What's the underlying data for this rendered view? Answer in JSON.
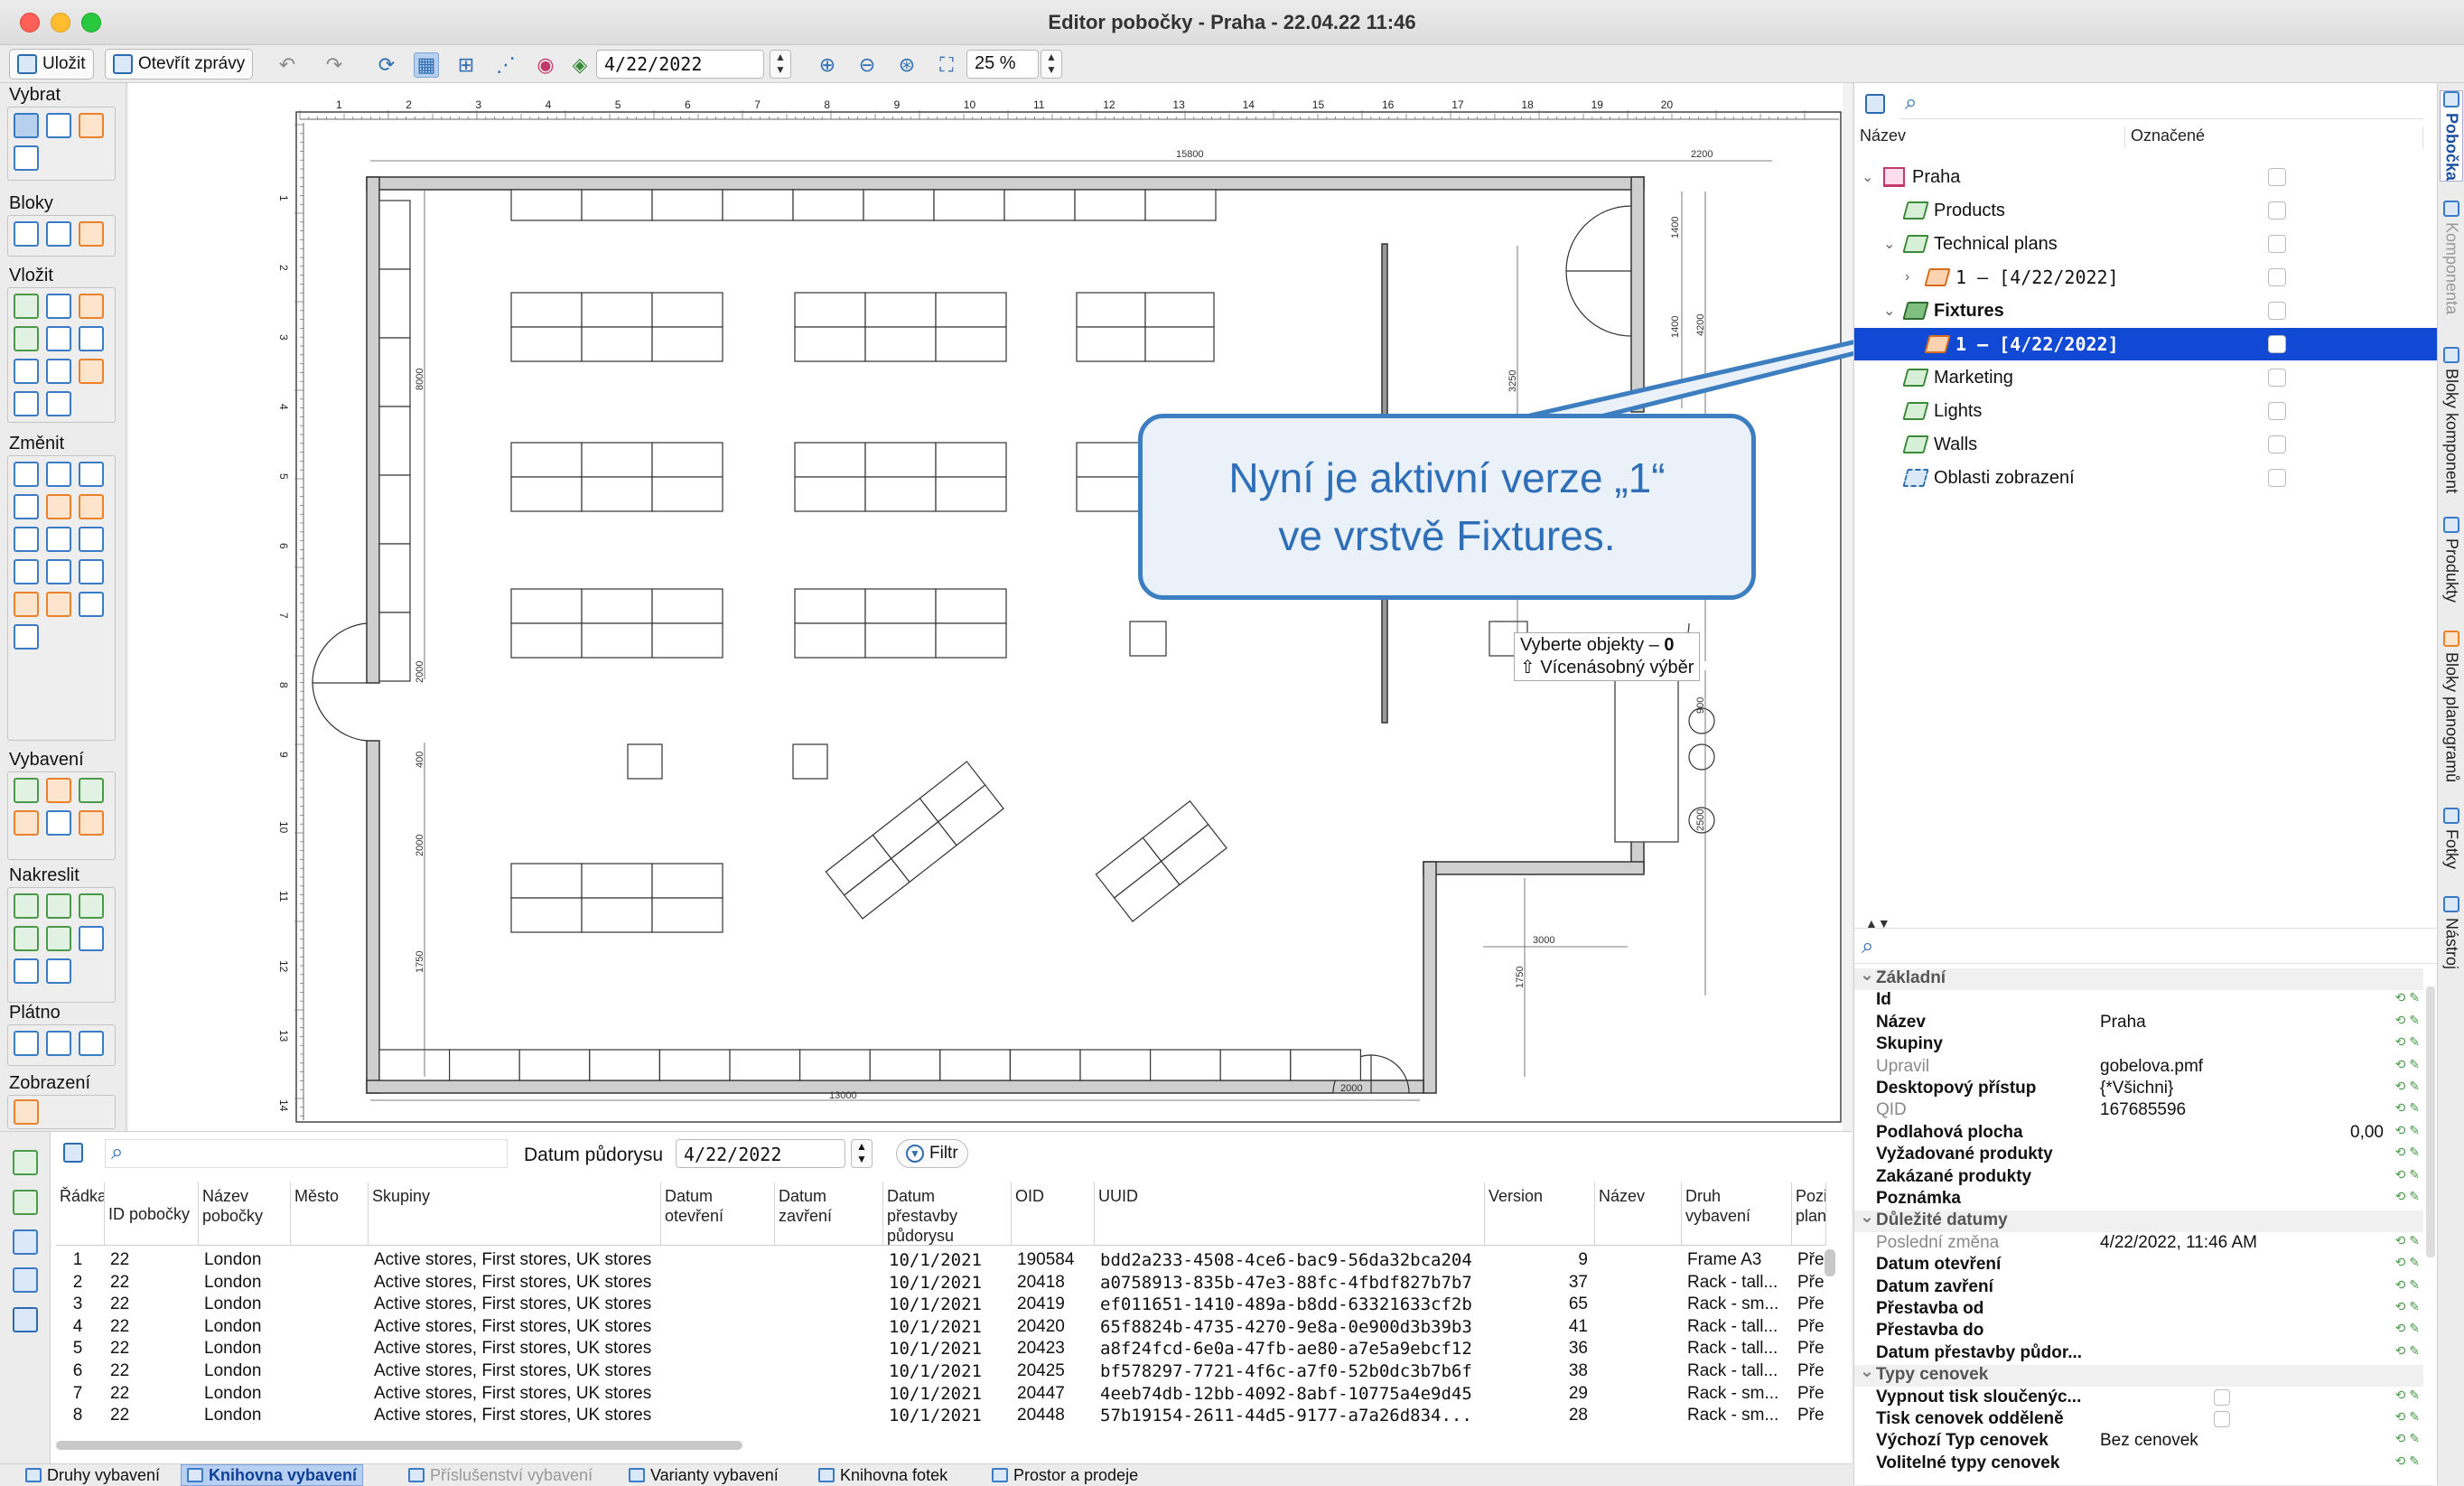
{
  "window": {
    "title": "Editor pobočky - Praha - 22.04.22 11:46"
  },
  "toolbar": {
    "save_label": "Uložit",
    "open_reports_label": "Otevřít zprávy",
    "date_value": "4/22/2022",
    "zoom_value": "25 %"
  },
  "palette": {
    "groups": [
      "Vybrat",
      "Bloky",
      "Vložit",
      "Změnit",
      "Vybavení",
      "Nakreslit",
      "Plátno",
      "Zobrazení"
    ]
  },
  "plan": {
    "ruler_top": [
      "1",
      "2",
      "3",
      "4",
      "5",
      "6",
      "7",
      "8",
      "9",
      "10",
      "11",
      "12",
      "13",
      "14",
      "15",
      "16",
      "17",
      "18",
      "19",
      "20"
    ],
    "ruler_left": [
      "1",
      "2",
      "3",
      "4",
      "5",
      "6",
      "7",
      "8",
      "9",
      "10",
      "11",
      "12",
      "13",
      "14"
    ],
    "dims": {
      "d15800": "15800",
      "d2200": "2200",
      "d8000": "8000",
      "d1400a": "1400",
      "d1400b": "1400",
      "d4200": "4200",
      "d3250": "3250",
      "d2000a": "2000",
      "d400": "400",
      "d2000b": "2000",
      "d1750a": "1750",
      "d900": "900",
      "d2500": "2500",
      "d3000": "3000",
      "d1750b": "1750",
      "d13000": "13000",
      "d2000c": "2000"
    }
  },
  "callout": {
    "line1": "Nyní je aktivní verze „1“",
    "line2": "ve vrstvě Fixtures."
  },
  "tooltip": {
    "line1": "Vyberte objekty – ",
    "count": "0",
    "line2": "⇧ Vícenásobný výběr"
  },
  "tree": {
    "col_name": "Název",
    "col_marked": "Označené",
    "items": [
      {
        "label": "Praha",
        "icon": "home-icon"
      },
      {
        "label": "Products",
        "icon": "layer-icon"
      },
      {
        "label": "Technical plans",
        "icon": "layer-icon"
      },
      {
        "label": "1 – [4/22/2022]",
        "icon": "layer-version-icon"
      },
      {
        "label": "Fixtures",
        "icon": "layer-icon"
      },
      {
        "label": "1 – [4/22/2022]",
        "icon": "layer-version-icon"
      },
      {
        "label": "Marketing",
        "icon": "layer-icon"
      },
      {
        "label": "Lights",
        "icon": "layer-icon"
      },
      {
        "label": "Walls",
        "icon": "layer-icon"
      },
      {
        "label": "Oblasti zobrazení",
        "icon": "view-area-icon"
      }
    ]
  },
  "vtabs": [
    "Pobočka",
    "Komponenta",
    "Bloky komponent",
    "Produkty",
    "Bloky planogramů",
    "Fotky",
    "Nástroj"
  ],
  "props": {
    "cat_basic": "Základní",
    "id": "Id",
    "name": "Název",
    "name_value": "Praha",
    "groups": "Skupiny",
    "edited": "Upravil",
    "edited_value": "gobelova.pmf",
    "desktop": "Desktopový přístup",
    "desktop_value": "{*Všichni}",
    "qid": "QID",
    "qid_value": "167685596",
    "floor": "Podlahová plocha",
    "floor_value": "0,00",
    "req": "Vyžadované produkty",
    "forbid": "Zakázané produkty",
    "note": "Poznámka",
    "cat_dates": "Důležité datumy",
    "lastchange": "Poslední změna",
    "lastchange_value": "4/22/2022, 11:46 AM",
    "open": "Datum otevření",
    "close": "Datum zavření",
    "rebuild_from": "Přestavba od",
    "rebuild_to": "Přestavba do",
    "rebuild_plan": "Datum přestavby půdor...",
    "cat_prices": "Typy cenovek",
    "print_off": "Vypnout tisk sloučenýc...",
    "print_sep": "Tisk cenovek odděleně",
    "default_type": "Výchozí Typ cenovek",
    "default_type_value": "Bez cenovek",
    "optional_types": "Volitelné typy cenovek"
  },
  "bottom": {
    "plan_date_label": "Datum půdorysu",
    "plan_date_value": "4/22/2022",
    "filter_label": "Filtr",
    "headers": [
      "Řádka",
      "ID pobočky",
      "Název pobočky",
      "Město",
      "Skupiny",
      "Datum otevření",
      "Datum zavření",
      "Datum přestavby půdorysu",
      "OID",
      "UUID",
      "Version",
      "Název",
      "Druh vybavení",
      "Pozice planogramu"
    ],
    "rows": [
      [
        "1",
        "22",
        "London",
        "",
        "Active stores, First stores, UK stores",
        "",
        "",
        "10/1/2021",
        "190584",
        "bdd2a233-4508-4ce6-bac9-56da32bca204",
        "9",
        "",
        "Frame A3",
        "Pře"
      ],
      [
        "2",
        "22",
        "London",
        "",
        "Active stores, First stores, UK stores",
        "",
        "",
        "10/1/2021",
        "20418",
        "a0758913-835b-47e3-88fc-4fbdf827b7b7",
        "37",
        "",
        "Rack - tall...",
        "Pře"
      ],
      [
        "3",
        "22",
        "London",
        "",
        "Active stores, First stores, UK stores",
        "",
        "",
        "10/1/2021",
        "20419",
        "ef011651-1410-489a-b8dd-63321633cf2b",
        "65",
        "",
        "Rack - sm...",
        "Pře"
      ],
      [
        "4",
        "22",
        "London",
        "",
        "Active stores, First stores, UK stores",
        "",
        "",
        "10/1/2021",
        "20420",
        "65f8824b-4735-4270-9e8a-0e900d3b39b3",
        "41",
        "",
        "Rack - tall...",
        "Pře"
      ],
      [
        "5",
        "22",
        "London",
        "",
        "Active stores, First stores, UK stores",
        "",
        "",
        "10/1/2021",
        "20423",
        "a8f24fcd-6e0a-47fb-ae80-a7e5a9ebcf12",
        "36",
        "",
        "Rack - tall...",
        "Pře"
      ],
      [
        "6",
        "22",
        "London",
        "",
        "Active stores, First stores, UK stores",
        "",
        "",
        "10/1/2021",
        "20425",
        "bf578297-7721-4f6c-a7f0-52b0dc3b7b6f",
        "38",
        "",
        "Rack - tall...",
        "Pře"
      ],
      [
        "7",
        "22",
        "London",
        "",
        "Active stores, First stores, UK stores",
        "",
        "",
        "10/1/2021",
        "20447",
        "4eeb74db-12bb-4092-8abf-10775a4e9d45",
        "29",
        "",
        "Rack - sm...",
        "Pře"
      ],
      [
        "8",
        "22",
        "London",
        "",
        "Active stores, First stores, UK stores",
        "",
        "",
        "10/1/2021",
        "20448",
        "57b19154-2611-44d5-9177-a7a26d834...",
        "28",
        "",
        "Rack - sm...",
        "Pře"
      ]
    ]
  },
  "statusbar": {
    "tabs": [
      "Druhy vybavení",
      "Knihovna vybavení",
      "Příslušenství vybavení",
      "Varianty vybavení",
      "Knihovna fotek",
      "Prostor a prodeje"
    ]
  }
}
